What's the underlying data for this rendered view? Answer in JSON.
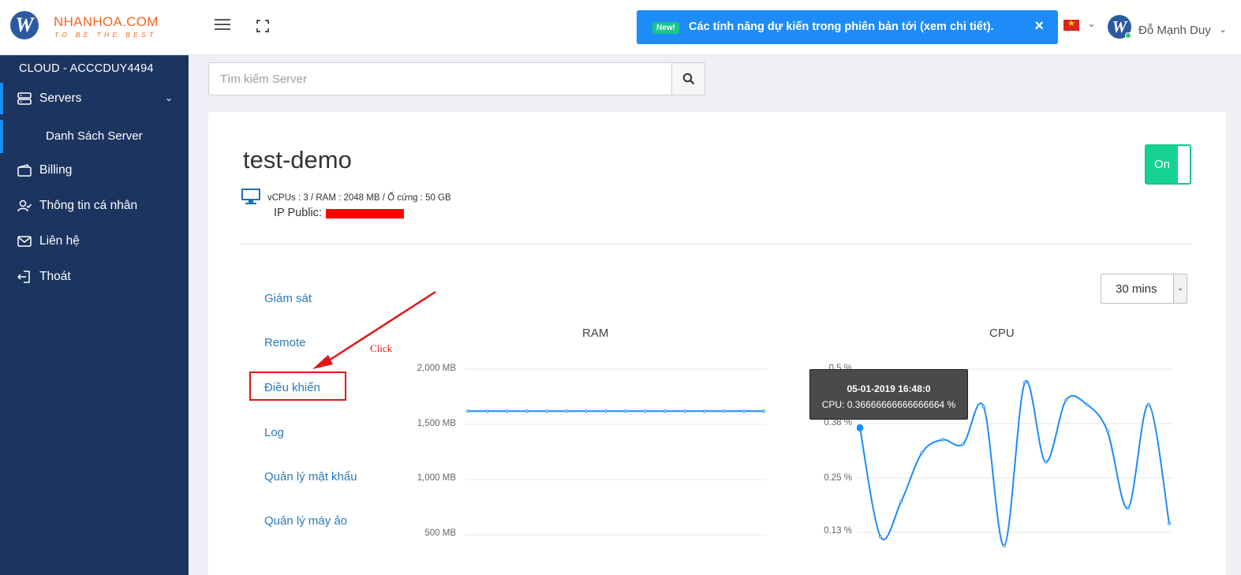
{
  "header": {
    "logo_letter": "W",
    "brand": "NHANHOA.COM",
    "tagline": "TO BE THE BEST",
    "notice_badge": "New!",
    "notice_text": "Các tính năng dự kiến trong phiên bản tới (xem chi tiết).",
    "notice_close": "×",
    "user_avatar_letter": "W",
    "user_name": "Đỗ Mạnh Duy"
  },
  "sidebar": {
    "title": "CLOUD - ACCCDUY4494",
    "items": [
      {
        "label": "Servers"
      },
      {
        "label": "Danh Sách Server"
      },
      {
        "label": "Billing"
      },
      {
        "label": "Thông tin cá nhân"
      },
      {
        "label": "Liên hệ"
      },
      {
        "label": "Thoát"
      }
    ]
  },
  "search": {
    "placeholder": "Tìm kiếm Server"
  },
  "server": {
    "name": "test-demo",
    "power_label": "On",
    "specs": "vCPUs : 3 / RAM : 2048 MB / Ổ cứng : 50 GB",
    "ip_label": "IP Public:"
  },
  "menu": [
    "Giám sát",
    "Remote",
    "Điều khiển",
    "Log",
    "Quản lý mật khẩu",
    "Quản lý máy ảo"
  ],
  "annotation": {
    "click_text": "Click",
    "color": "#e01515"
  },
  "range_select": {
    "selected": "30 mins"
  },
  "colors": {
    "sidebar": "#1c3460",
    "accent": "#1d8cf8",
    "on": "#16d293",
    "line": "#1d8cf8"
  },
  "chart_data": [
    {
      "type": "line",
      "title": "RAM",
      "ytick_labels": [
        "2,000 MB",
        "1,500 MB",
        "1,000 MB",
        "500 MB"
      ],
      "ylim": [
        500,
        2000
      ],
      "values": [
        1620,
        1620,
        1620,
        1620,
        1620,
        1620,
        1620,
        1620,
        1620,
        1620,
        1620,
        1620,
        1620,
        1620,
        1620,
        1620
      ]
    },
    {
      "type": "line",
      "title": "CPU",
      "ytick_labels": [
        "0.5 %",
        "0.38 %",
        "0.25 %",
        "0.13 %"
      ],
      "ylim": [
        0.13,
        0.5
      ],
      "values": [
        0.367,
        0.12,
        0.2,
        0.31,
        0.34,
        0.33,
        0.415,
        0.1,
        0.47,
        0.29,
        0.43,
        0.42,
        0.36,
        0.185,
        0.42,
        0.15
      ],
      "tooltip": {
        "date": "05-01-2019 16:48:0",
        "text": "CPU: 0.36666666666666664 %"
      }
    }
  ]
}
